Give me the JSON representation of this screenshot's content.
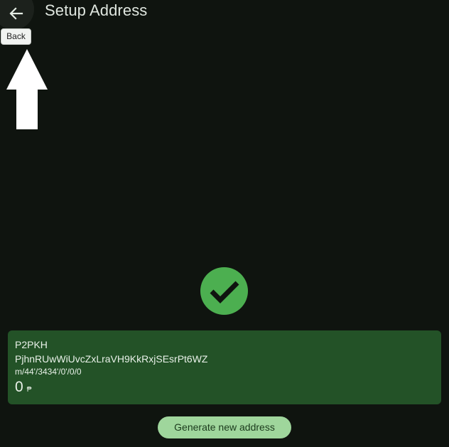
{
  "header": {
    "title": "Setup Address",
    "back_icon": "arrow-left-icon",
    "back_tooltip": "Back"
  },
  "status": {
    "icon": "check-circle-icon",
    "color": "#4caf50"
  },
  "address_card": {
    "type": "P2PKH",
    "address": "PjhnRUwWiUvcZxLraVH9KkRxjSEsrPt6WZ",
    "derivation_path": "m/44'/3434'/0'/0/0",
    "balance": "0",
    "currency_symbol": "₱",
    "background": "#235227"
  },
  "actions": {
    "generate_label": "Generate new address",
    "button_color": "#9fd69c"
  },
  "overlay": {
    "pointer_icon": "up-arrow-icon"
  }
}
